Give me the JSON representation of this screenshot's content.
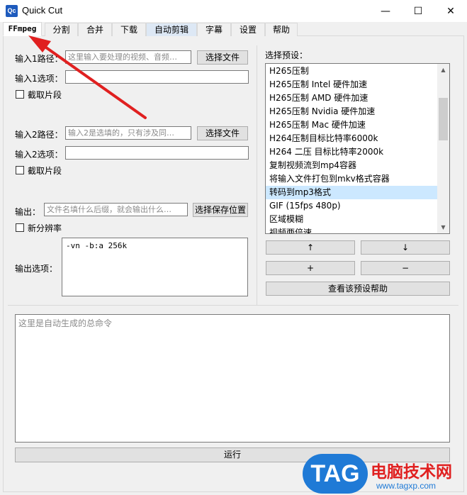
{
  "window": {
    "icon_text": "Qc",
    "title": "Quick Cut",
    "minimize": "—",
    "maximize": "☐",
    "close": "✕"
  },
  "tabs": [
    {
      "label": "FFmpeg"
    },
    {
      "label": "分割"
    },
    {
      "label": "合并"
    },
    {
      "label": "下载"
    },
    {
      "label": "自动剪辑"
    },
    {
      "label": "字幕"
    },
    {
      "label": "设置"
    },
    {
      "label": "帮助"
    }
  ],
  "input1": {
    "path_label": "输入1路径：",
    "path_placeholder": "这里输入要处理的视频、音频…",
    "choose_button": "选择文件",
    "options_label": "输入1选项：",
    "options_value": "",
    "clip_label": "截取片段"
  },
  "input2": {
    "path_label": "输入2路径：",
    "path_placeholder": "输入2是选填的，只有涉及同…",
    "choose_button": "选择文件",
    "options_label": "输入2选项：",
    "options_value": "",
    "clip_label": "截取片段"
  },
  "output": {
    "label": "输出：",
    "placeholder": "文件名填什么后缀，就会输出什么…",
    "save_button": "选择保存位置",
    "new_resolution_label": "新分辨率",
    "options_label": "输出选项：",
    "options_value": "-vn -b:a 256k"
  },
  "presets": {
    "label": "选择预设：",
    "items": [
      "H265压制",
      "H265压制 Intel 硬件加速",
      "H265压制 AMD 硬件加速",
      "H265压制 Nvidia 硬件加速",
      "H265压制 Mac 硬件加速",
      "H264压制目标比特率6000k",
      "H264 二压 目标比特率2000k",
      "复制视频流到mp4容器",
      "将输入文件打包到mkv格式容器",
      "转码到mp3格式",
      "GIF (15fps 480p)",
      "区域模糊",
      "视频两倍速"
    ],
    "selected_index": 9,
    "up_button": "↑",
    "down_button": "↓",
    "add_button": "+",
    "remove_button": "−",
    "help_button": "查看该预设帮助"
  },
  "command": {
    "placeholder": "这里是自动生成的总命令"
  },
  "run_button": "运行",
  "watermark": {
    "logo": "TAG",
    "site_name": "电脑技术网",
    "url": "www.tagxp.com"
  },
  "colors": {
    "selection": "#cce8ff",
    "annotation_arrow": "#e02020",
    "watermark_blue": "#1f7ad6"
  }
}
